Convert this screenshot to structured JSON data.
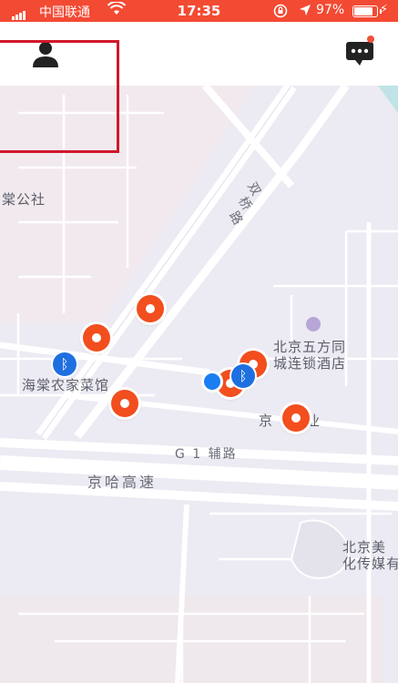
{
  "status_bar": {
    "carrier": "中国联通",
    "time": "17:35",
    "battery": "97%"
  },
  "header": {
    "profile_icon": "person-icon",
    "chat_icon": "chat-bubble-icon",
    "has_unread": true
  },
  "map": {
    "place_labels": [
      {
        "id": "shetuan",
        "text": "棠公社"
      },
      {
        "id": "hotel-1",
        "text": "北京五方同"
      },
      {
        "id": "hotel-2",
        "text": "城连锁酒店"
      },
      {
        "id": "restaurant",
        "text": "海棠农家菜馆"
      },
      {
        "id": "jingye",
        "text": "京"
      },
      {
        "id": "jingye-2",
        "text": "业"
      },
      {
        "id": "media-1",
        "text": "北京美"
      },
      {
        "id": "media-2",
        "text": "化传媒有"
      }
    ],
    "road_labels": {
      "shuangqiao_1": "双",
      "shuangqiao_2": "桥",
      "shuangqiao_3": "路",
      "g1": "G 1 辅路",
      "jingha": "京哈高速"
    }
  },
  "colors": {
    "accent": "#f24e1e",
    "status_bar": "#f34a33",
    "bluetooth": "#1e6fe0",
    "location": "#1a7ef2"
  }
}
